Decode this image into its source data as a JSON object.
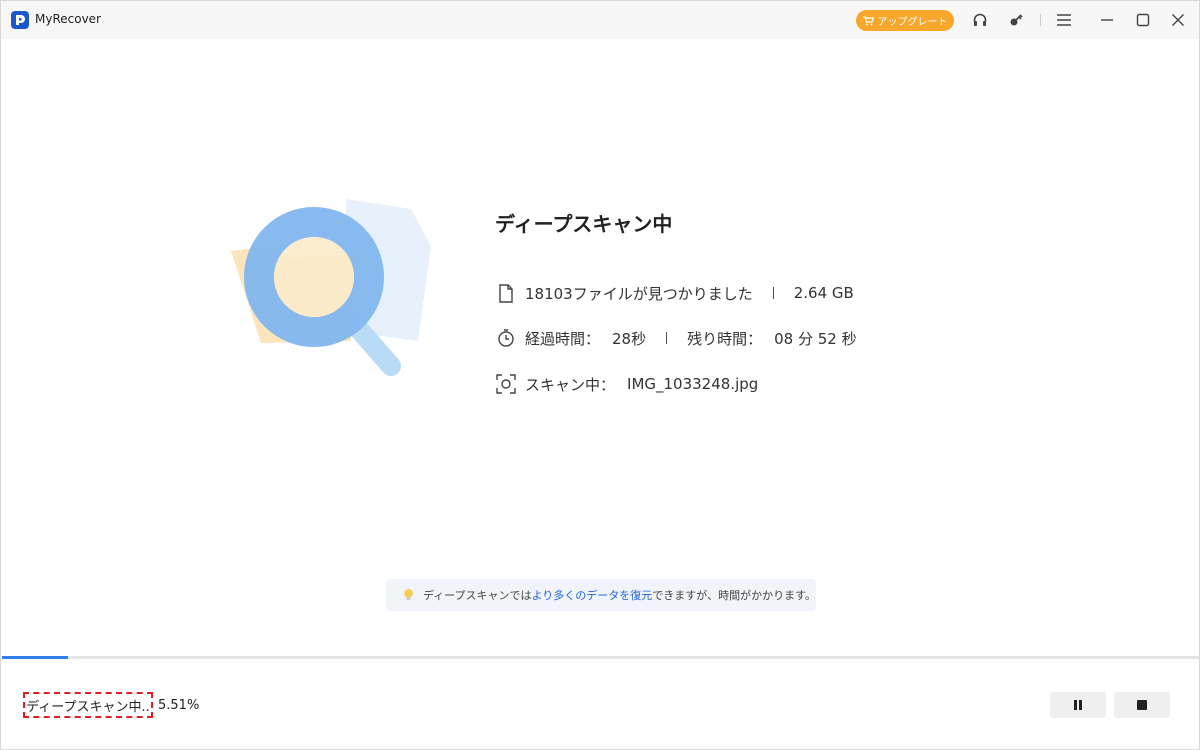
{
  "app": {
    "title": "MyRecover",
    "upgrade_label": "アップグレート",
    "accent": "#f7a72a",
    "brand": "#1a57c9"
  },
  "titlebar_icons": [
    "headset-icon",
    "key-icon",
    "menu-icon",
    "minimize-icon",
    "maximize-icon",
    "close-icon"
  ],
  "scan": {
    "title": "ディープスキャン中",
    "files_found": "18103ファイルが見つかりました",
    "size": "2.64 GB",
    "elapsed_label": "経過時間：",
    "elapsed_value": "28秒",
    "remaining_label": "残り時間：",
    "remaining_value": "08 分 52 秒",
    "scanning_label": "スキャン中：",
    "scanning_file": "IMG_1033248.jpg"
  },
  "tip": {
    "prefix": "ディープスキャンでは",
    "highlight": "より多くのデータを復元",
    "suffix": "できますが、時間がかかります。"
  },
  "progress": {
    "status": "ディープスキャン中..",
    "percent_text": "5.51%",
    "fraction": 0.0551,
    "color": "#2f80ed"
  }
}
